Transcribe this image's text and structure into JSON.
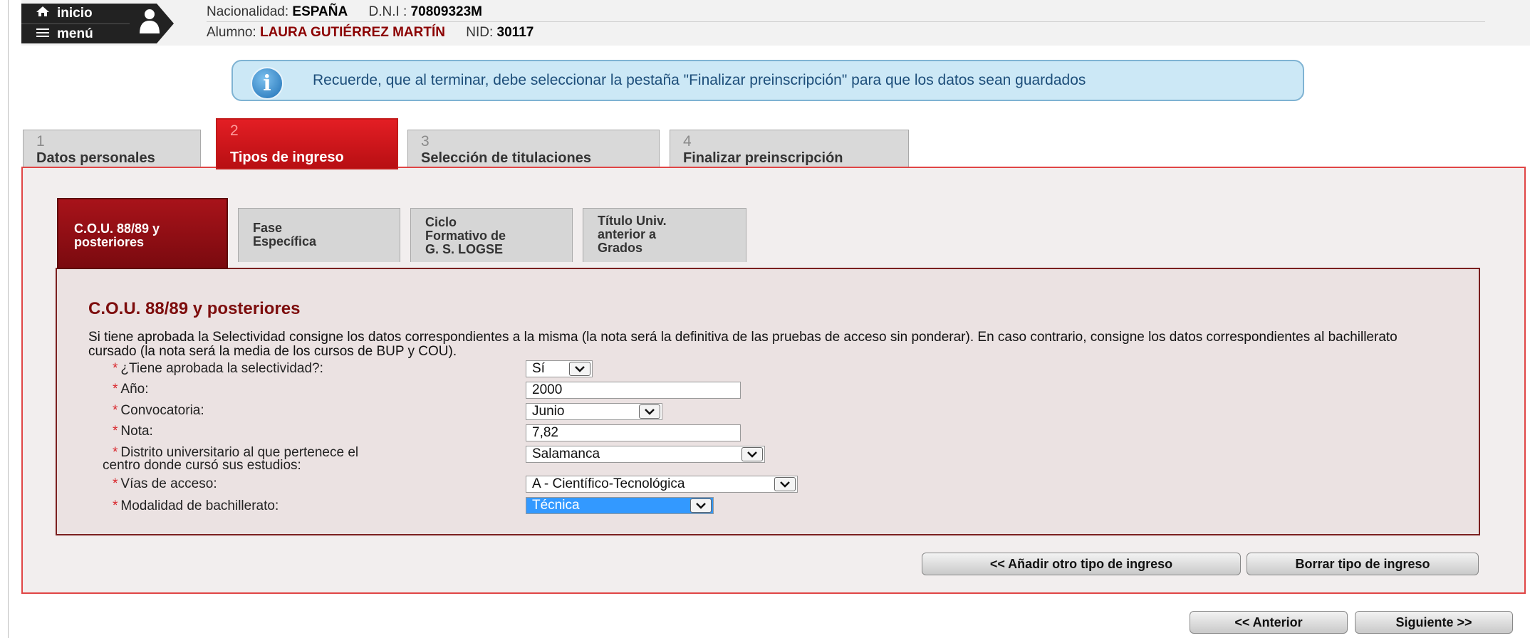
{
  "header": {
    "inicio_label": "inicio",
    "menu_label": "menú",
    "nacionalidad_label": "Nacionalidad:",
    "nacionalidad_value": "ESPAÑA",
    "dni_label": "D.N.I :",
    "dni_value": "70809323M",
    "alumno_label": "Alumno:",
    "alumno_value": "LAURA GUTIÉRREZ MARTÍN",
    "nid_label": "NID:",
    "nid_value": "30117"
  },
  "notice": {
    "icon": "info-icon",
    "text": "Recuerde, que al terminar, debe seleccionar la pestaña \"Finalizar preinscripción\" para que los datos sean guardados"
  },
  "tabs": [
    {
      "num": "1",
      "label": "Datos personales"
    },
    {
      "num": "2",
      "label": "Tipos de ingreso"
    },
    {
      "num": "3",
      "label": "Selección de titulaciones"
    },
    {
      "num": "4",
      "label": "Finalizar preinscripción"
    }
  ],
  "subtabs": [
    {
      "line1": "C.O.U. 88/89 y",
      "line2": "posteriores",
      "line3": ""
    },
    {
      "line1": "Fase",
      "line2": "Específica",
      "line3": ""
    },
    {
      "line1": "Ciclo",
      "line2": "Formativo de",
      "line3": "G. S. LOGSE"
    },
    {
      "line1": "Título Univ.",
      "line2": "anterior a",
      "line3": "Grados"
    }
  ],
  "section": {
    "title": "C.O.U. 88/89 y posteriores",
    "description": "Si tiene aprobada la Selectividad consigne los datos correspondientes a la misma (la nota será la definitiva de las pruebas de acceso sin ponderar). En caso contrario, consigne los datos correspondientes al bachillerato cursado (la nota será la media de los cursos de BUP y COU)."
  },
  "form": {
    "required_mark": "*",
    "selectividad_label": "¿Tiene aprobada la selectividad?:",
    "selectividad_value": "Sí",
    "anio_label": "Año:",
    "anio_value": "2000",
    "convocatoria_label": "Convocatoria:",
    "convocatoria_value": "Junio",
    "nota_label": "Nota:",
    "nota_value": "7,82",
    "distrito_label_1": "Distrito universitario al que pertenece el",
    "distrito_label_2": "centro donde cursó sus estudios:",
    "distrito_value": "Salamanca",
    "vias_label": "Vías de acceso:",
    "vias_value": "A - Científico-Tecnológica",
    "modalidad_label": "Modalidad de bachillerato:",
    "modalidad_value": "Técnica"
  },
  "buttons": {
    "add_type": "<< Añadir otro tipo de ingreso",
    "delete_type": "Borrar tipo de ingreso",
    "previous": "<< Anterior",
    "next": "Siguiente >>"
  }
}
